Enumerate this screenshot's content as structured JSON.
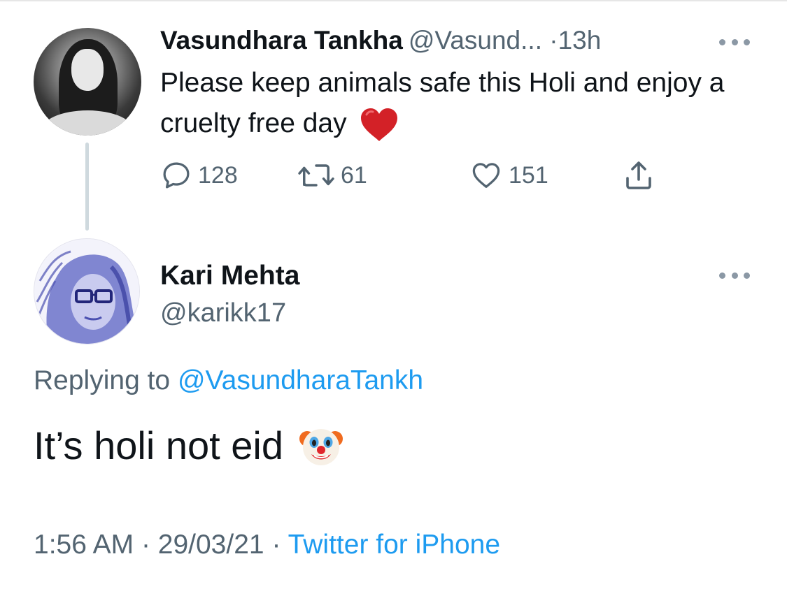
{
  "parent_tweet": {
    "author_name": "Vasundhara Tankha",
    "author_handle": "@Vasund...",
    "separator": "·",
    "time": "13h",
    "text": "Please keep animals safe this Holi and enjoy a cruelty free day",
    "emoji": "red-heart",
    "reply_count": "128",
    "retweet_count": "61",
    "like_count": "151"
  },
  "reply_tweet": {
    "author_name": "Kari Mehta",
    "author_handle": "@karikk17",
    "replying_prefix": "Replying to",
    "replying_to": "@VasundharaTankh",
    "text": "It’s holi not eid",
    "emoji": "clown-face",
    "time": "1:56 AM",
    "date": "29/03/21",
    "separator": "·",
    "source": "Twitter for iPhone"
  },
  "colors": {
    "text": "#0f1419",
    "secondary": "#536471",
    "link": "#1d9bf0",
    "thread_line": "#cfd9de"
  }
}
